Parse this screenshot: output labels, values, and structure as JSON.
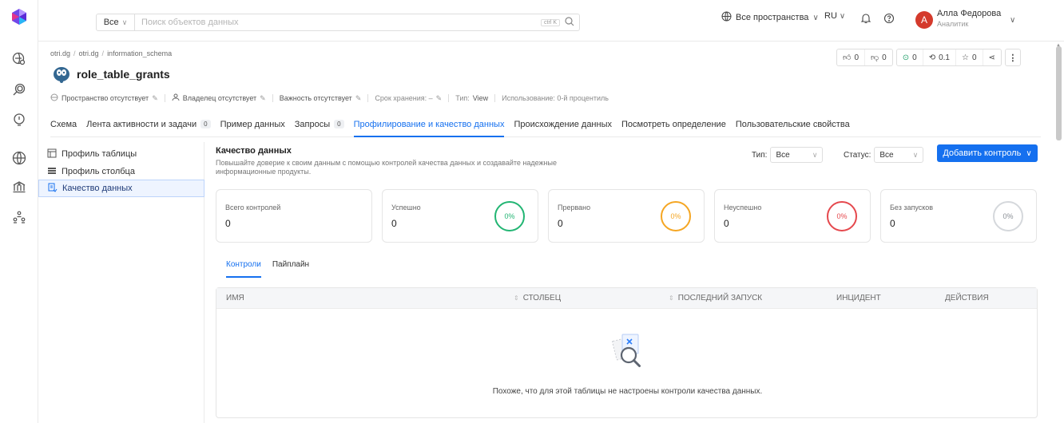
{
  "topbar": {
    "search_scope": "Все",
    "search_placeholder": "Поиск объектов данных",
    "shortcut": "ctrl K",
    "domains": "Все пространства",
    "language": "RU",
    "user_initial": "A",
    "user_name": "Алла Федорова",
    "user_role": "Аналитик"
  },
  "breadcrumb": [
    "otri.dg",
    "otri.dg",
    "information_schema"
  ],
  "entity": {
    "name": "role_table_grants",
    "meta": {
      "domain": "Пространство отсутствует",
      "owner": "Владелец отсутствует",
      "tier": "Важность отсутствует",
      "retention": "Срок хранения: –",
      "type_label": "Тип:",
      "type_value": "View",
      "usage": "Использование: 0-й процентиль"
    }
  },
  "actions": {
    "likes": "0",
    "dislikes": "0",
    "followers": "0",
    "version": "0.1",
    "stars": "0"
  },
  "tabs": [
    {
      "label": "Схема"
    },
    {
      "label": "Лента активности и задачи",
      "count": "0"
    },
    {
      "label": "Пример данных"
    },
    {
      "label": "Запросы",
      "count": "0"
    },
    {
      "label": "Профилирование и качество данных",
      "active": true
    },
    {
      "label": "Происхождение данных"
    },
    {
      "label": "Посмотреть определение"
    },
    {
      "label": "Пользовательские свойства"
    }
  ],
  "left_panel": {
    "items": [
      "Профиль таблицы",
      "Профиль столбца",
      "Качество данных"
    ]
  },
  "quality": {
    "title": "Качество данных",
    "subtitle": "Повышайте доверие к своим данным с помощью контролей качества данных и создавайте надежные информационные продукты.",
    "type_label": "Тип:",
    "type_value": "Все",
    "status_label": "Статус:",
    "status_value": "Все",
    "add_button": "Добавить контроль"
  },
  "cards": [
    {
      "label": "Всего контролей",
      "value": "0"
    },
    {
      "label": "Успешно",
      "value": "0",
      "percent": "0%",
      "color": "#22b573"
    },
    {
      "label": "Прервано",
      "value": "0",
      "percent": "0%",
      "color": "#f5a623"
    },
    {
      "label": "Неуспешно",
      "value": "0",
      "percent": "0%",
      "color": "#e5484d"
    },
    {
      "label": "Без запусков",
      "value": "0",
      "percent": "0%",
      "color": "#9aa0a6"
    }
  ],
  "subtabs": [
    "Контроли",
    "Пайплайн"
  ],
  "table": {
    "columns": [
      "ИМЯ",
      "СТОЛБЕЦ",
      "ПОСЛЕДНИЙ ЗАПУСК",
      "ИНЦИДЕНТ",
      "ДЕЙСТВИЯ"
    ],
    "empty_text": "Похоже, что для этой таблицы не настроены контроли качества данных."
  }
}
